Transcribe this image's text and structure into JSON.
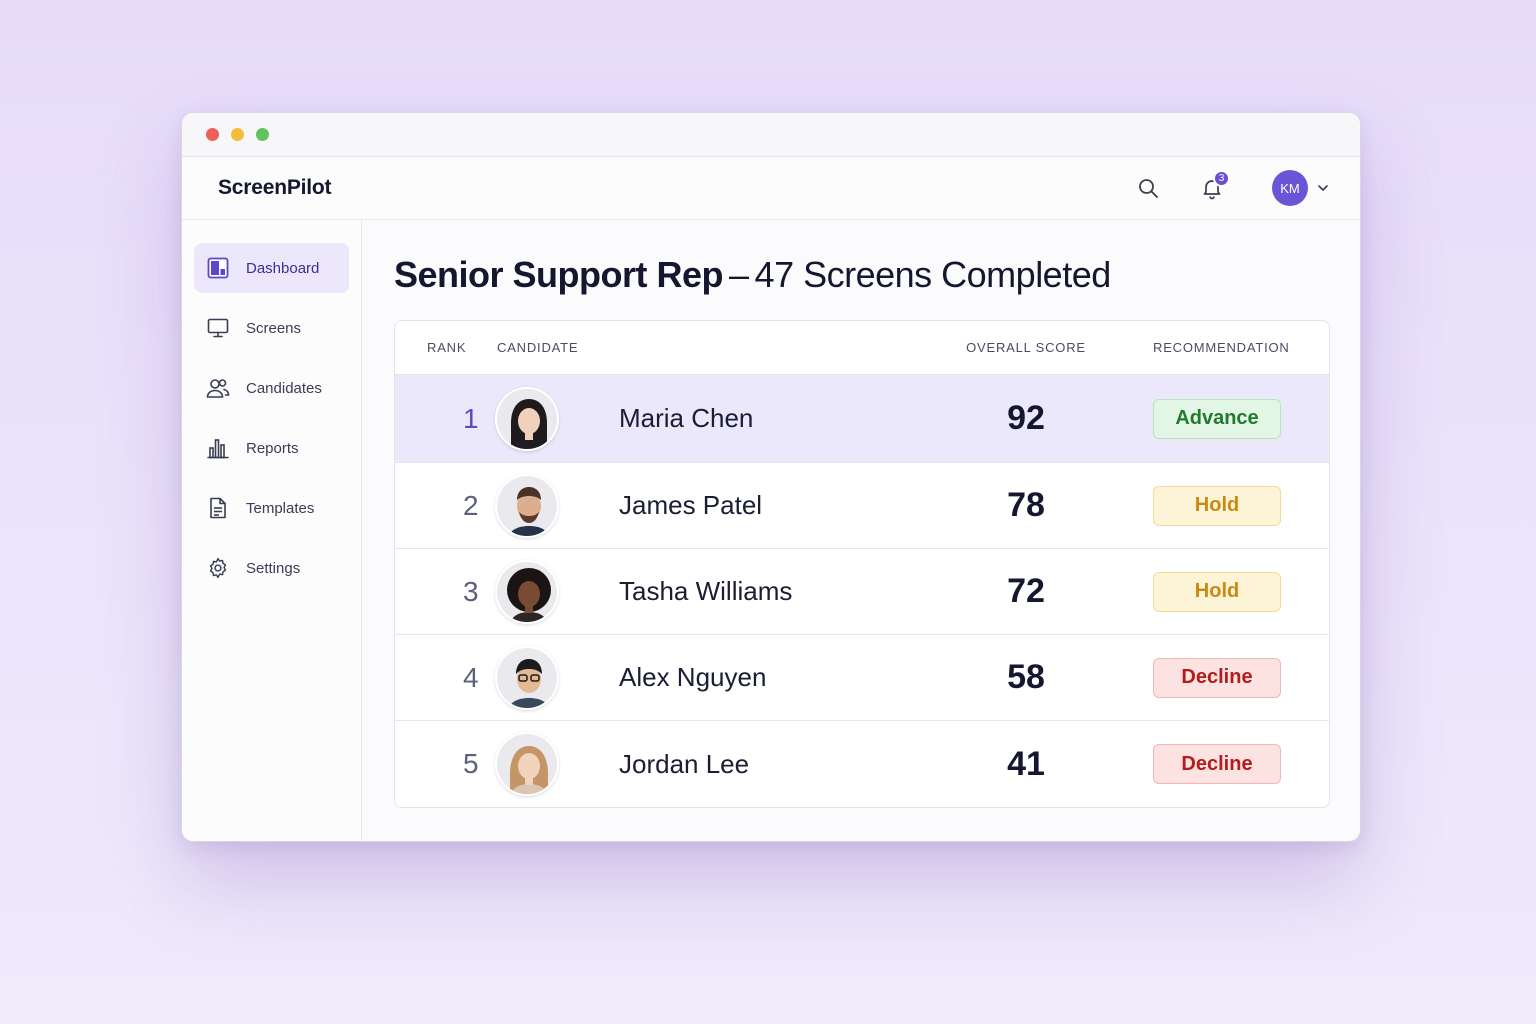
{
  "app": {
    "brand": "ScreenPilot"
  },
  "header": {
    "notifications_count": "3",
    "user_initials": "KM"
  },
  "sidebar": {
    "items": [
      {
        "label": "Dashboard",
        "icon": "dashboard-icon",
        "active": true
      },
      {
        "label": "Screens",
        "icon": "monitor-icon"
      },
      {
        "label": "Candidates",
        "icon": "users-icon"
      },
      {
        "label": "Reports",
        "icon": "bar-chart-icon"
      },
      {
        "label": "Templates",
        "icon": "document-icon"
      },
      {
        "label": "Settings",
        "icon": "gear-icon"
      }
    ]
  },
  "page": {
    "title_strong": "Senior Support Rep",
    "title_sep": "–",
    "title_light": "47 Screens Completed"
  },
  "table": {
    "headers": {
      "rank": "RANK",
      "candidate": "CANDIDATE",
      "score": "OVERALL SCORE",
      "recommendation": "RECOMMENDATION"
    },
    "rows": [
      {
        "rank": "1",
        "name": "Maria Chen",
        "score": "92",
        "recommendation": "Advance",
        "status": "advance"
      },
      {
        "rank": "2",
        "name": "James Patel",
        "score": "78",
        "recommendation": "Hold",
        "status": "hold"
      },
      {
        "rank": "3",
        "name": "Tasha Williams",
        "score": "72",
        "recommendation": "Hold",
        "status": "hold"
      },
      {
        "rank": "4",
        "name": "Alex Nguyen",
        "score": "58",
        "recommendation": "Decline",
        "status": "decline"
      },
      {
        "rank": "5",
        "name": "Jordan Lee",
        "score": "41",
        "recommendation": "Decline",
        "status": "decline"
      }
    ]
  },
  "colors": {
    "accent": "#6b55d6",
    "advance": "#227a30",
    "hold": "#c88a12",
    "decline": "#b21d1d"
  }
}
